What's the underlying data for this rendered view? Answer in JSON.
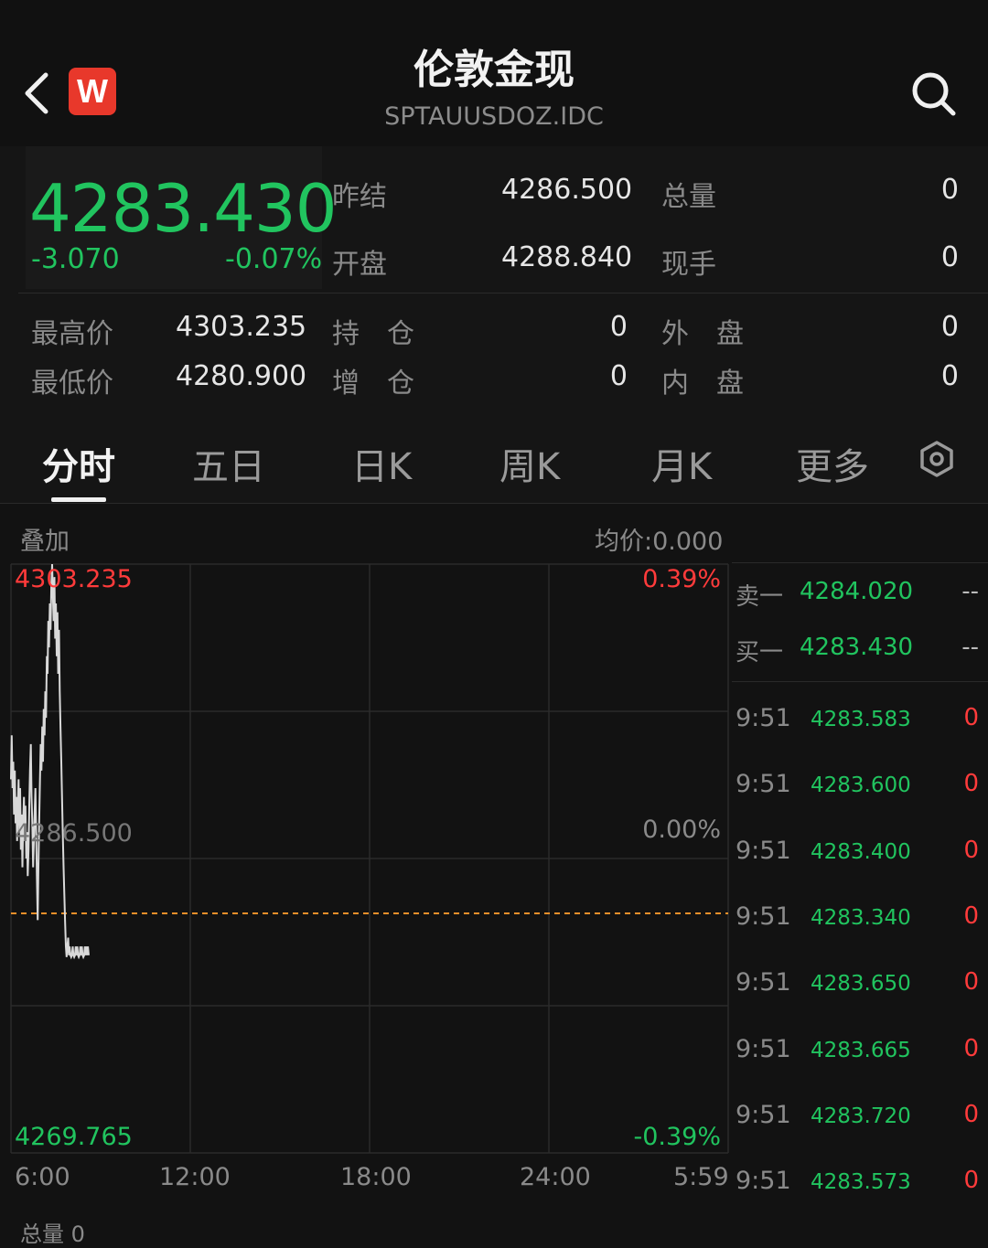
{
  "header": {
    "title": "伦敦金现",
    "subtitle": "SPTAUUSDOZ.IDC",
    "logo_text": "W"
  },
  "quote": {
    "price": "4283.430",
    "change": "-3.070",
    "change_pct": "-0.07%",
    "rows": [
      {
        "label": "昨结",
        "value": "4286.500",
        "label2": "总量",
        "value2": "0"
      },
      {
        "label": "开盘",
        "value": "4288.840",
        "label2": "现手",
        "value2": "0"
      }
    ],
    "rows2": [
      {
        "label": "最高价",
        "value": "4303.235",
        "label2": "持　仓",
        "value2": "0",
        "label3": "外　盘",
        "value3": "0"
      },
      {
        "label": "最低价",
        "value": "4280.900",
        "label2": "增　仓",
        "value2": "0",
        "label3": "内　盘",
        "value3": "0"
      }
    ]
  },
  "tabs": [
    "分时",
    "五日",
    "日K",
    "周K",
    "月K",
    "更多"
  ],
  "active_tab": "分时",
  "chart": {
    "overlay_label": "叠加",
    "avg_label": "均价:0.000",
    "y_high": "4303.235",
    "y_mid": "4286.500",
    "y_low": "4269.765",
    "pct_high": "0.39%",
    "pct_mid": "0.00%",
    "pct_low": "-0.39%",
    "x_labels": [
      "6:00",
      "12:00",
      "18:00",
      "24:00",
      "5:59"
    ],
    "bottom_label": "总量 0"
  },
  "chart_data": {
    "type": "line",
    "series": [
      {
        "x": [
          0,
          0.02,
          0.04,
          0.06,
          0.08,
          0.1,
          0.12,
          0.14,
          0.16,
          0.18,
          0.2,
          0.22,
          0.24,
          0.26,
          0.28,
          0.3,
          0.32,
          0.34,
          0.36,
          0.38,
          0.4,
          0.42,
          0.44,
          0.46,
          0.48,
          0.5,
          0.52,
          0.54,
          0.56,
          0.58,
          0.6,
          0.62,
          0.64,
          0.66,
          0.68,
          0.7,
          0.72,
          0.74,
          0.76,
          0.78,
          0.8,
          0.82,
          0.84,
          0.86,
          0.88,
          0.9,
          0.92,
          0.94,
          0.96,
          0.98,
          1.0,
          1.02,
          1.04,
          1.06,
          1.08,
          1.1,
          1.12,
          1.14,
          1.16,
          1.18,
          1.2,
          1.22,
          1.24,
          1.26,
          1.28,
          1.3,
          1.32,
          1.34,
          1.36,
          1.38,
          1.4,
          1.42,
          1.44,
          1.46,
          1.48,
          1.5,
          1.52,
          1.54,
          1.56,
          1.58,
          1.6,
          1.62,
          1.64,
          1.66,
          1.68,
          1.7,
          1.72,
          1.74,
          1.76,
          1.78,
          1.8,
          1.82,
          1.84,
          1.86,
          1.88,
          1.9,
          1.92,
          1.94,
          1.96,
          1.98,
          2.0,
          2.02,
          2.04
        ],
        "values": [
          4291.0,
          4293.5,
          4290.5,
          4292.0,
          4289.0,
          4291.5,
          4288.5,
          4290.0,
          4287.5,
          4289.5,
          4291.0,
          4288.0,
          4290.5,
          4287.0,
          4289.0,
          4286.0,
          4288.5,
          4290.0,
          4287.5,
          4289.5,
          4286.5,
          4288.0,
          4285.5,
          4287.0,
          4289.5,
          4291.5,
          4293.0,
          4290.0,
          4288.5,
          4286.0,
          4287.5,
          4289.0,
          4290.5,
          4288.0,
          4285.5,
          4283.0,
          4286.0,
          4288.5,
          4291.0,
          4293.0,
          4291.5,
          4294.0,
          4292.0,
          4295.0,
          4293.5,
          4296.0,
          4294.5,
          4298.0,
          4297.0,
          4300.0,
          4298.5,
          4301.0,
          4299.5,
          4302.0,
          4303.235,
          4301.5,
          4300.0,
          4302.5,
          4299.0,
          4301.0,
          4298.0,
          4300.5,
          4297.0,
          4299.5,
          4296.0,
          4294.0,
          4292.0,
          4290.0,
          4288.0,
          4286.0,
          4284.5,
          4283.0,
          4281.5,
          4280.9,
          4281.5,
          4282.0,
          4281.0,
          4281.5,
          4281.0,
          4280.9,
          4281.0,
          4281.5,
          4281.0,
          4280.9,
          4281.0,
          4281.5,
          4281.0,
          4281.5,
          4281.0,
          4280.9,
          4281.0,
          4281.5,
          4281.0,
          4281.5,
          4281.0,
          4280.9,
          4281.0,
          4281.5,
          4281.0,
          4281.5,
          4281.0,
          4281.5,
          4281.0
        ]
      }
    ],
    "ylim": [
      4269.765,
      4303.235
    ],
    "x_labels": [
      "6:00",
      "12:00",
      "18:00",
      "24:00",
      "5:59"
    ],
    "reference_value": 4286.5
  },
  "orderbook": {
    "sell_label": "卖一",
    "sell_price": "4284.020",
    "sell_vol": "--",
    "buy_label": "买一",
    "buy_price": "4283.430",
    "buy_vol": "--"
  },
  "trades": [
    {
      "time": "9:51",
      "price": "4283.583",
      "vol": "0"
    },
    {
      "time": "9:51",
      "price": "4283.600",
      "vol": "0"
    },
    {
      "time": "9:51",
      "price": "4283.400",
      "vol": "0"
    },
    {
      "time": "9:51",
      "price": "4283.340",
      "vol": "0"
    },
    {
      "time": "9:51",
      "price": "4283.650",
      "vol": "0"
    },
    {
      "time": "9:51",
      "price": "4283.665",
      "vol": "0"
    },
    {
      "time": "9:51",
      "price": "4283.720",
      "vol": "0"
    },
    {
      "time": "9:51",
      "price": "4283.573",
      "vol": "0"
    }
  ],
  "colors": {
    "up": "#ff3b3b",
    "down": "#21c45f",
    "line": "#d9d9d9",
    "ref_line": "#f0902a"
  }
}
